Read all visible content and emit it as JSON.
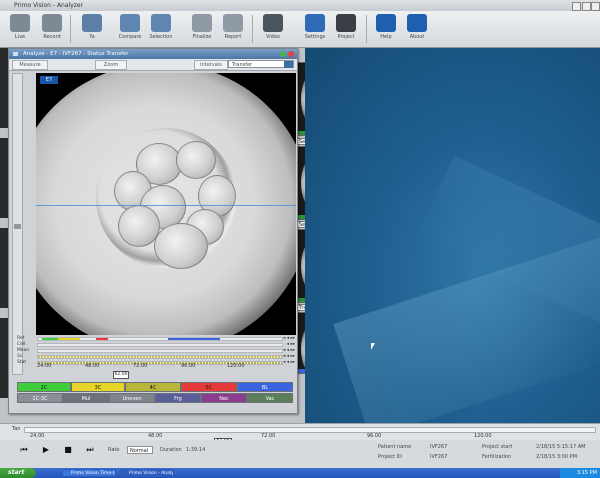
{
  "app": {
    "title": "Primo Vision - Analyzer"
  },
  "toolbar": {
    "items": [
      {
        "label": "Live",
        "icon": "live-icon",
        "color": "#7d8a96"
      },
      {
        "label": "Record",
        "icon": "record-icon",
        "color": "#7d8a96"
      },
      {
        "label": "Ya",
        "icon": "monitor-icon",
        "color": "#5b7fa6"
      },
      {
        "label": "Compare",
        "icon": "compare-icon",
        "color": "#5f86b0"
      },
      {
        "label": "Selection",
        "icon": "selection-icon",
        "color": "#5f86b0"
      },
      {
        "label": "Finalize",
        "icon": "finalize-icon",
        "color": "#8f9aa4"
      },
      {
        "label": "Report",
        "icon": "report-icon",
        "color": "#8f9aa4"
      },
      {
        "label": "Video",
        "icon": "video-icon",
        "color": "#4b5560"
      },
      {
        "label": "Settings",
        "icon": "settings-icon",
        "color": "#2e6bb8"
      },
      {
        "label": "Project",
        "icon": "project-icon",
        "color": "#3a3f45"
      },
      {
        "label": "Help",
        "icon": "help-icon",
        "color": "#1f5fb0"
      },
      {
        "label": "About",
        "icon": "about-icon",
        "color": "#1f5fb0"
      }
    ]
  },
  "analyzer": {
    "window_title": "Analyze - E7 - IVF267 - Status Transfer",
    "toolbar": {
      "measure": "Measure",
      "zoom": "Zoom",
      "intervals": "Intervals",
      "mode_value": "Transfer"
    },
    "embryo_label": "E7",
    "tracks": [
      {
        "name": "Ref",
        "marks": "◂ ◂ ▸▸"
      },
      {
        "name": "Cell",
        "marks": "◂ ▸▸"
      },
      {
        "name": "Mean",
        "marks": "◂ ◂ ▸▸"
      },
      {
        "name": "Sc",
        "marks": "◂ ◂ ▸▸"
      },
      {
        "name": "Stat",
        "marks": "◂ ◂ ▸▸"
      }
    ],
    "time_ticks": [
      "24.00",
      "48.00",
      "72.00",
      "96.00",
      "120.00"
    ],
    "position_value": "62.00",
    "classes_row1": [
      {
        "label": "2C",
        "color": "#3fce3a"
      },
      {
        "label": "3C",
        "color": "#e7d629"
      },
      {
        "label": "4C",
        "color": "#b7b53c"
      },
      {
        "label": "5C",
        "color": "#e63a3a"
      },
      {
        "label": "BL",
        "color": "#3a64e0"
      }
    ],
    "classes_row2": [
      {
        "label": "1C-3C",
        "color": "#8a8f96"
      },
      {
        "label": "Mul",
        "color": "#6d7279"
      },
      {
        "label": "Uneven",
        "color": "#7f838a"
      },
      {
        "label": "Frg",
        "color": "#5b5f99"
      },
      {
        "label": "Nec",
        "color": "#8a3c8f"
      },
      {
        "label": "Vac",
        "color": "#5b7f5b"
      }
    ]
  },
  "thumbnails": [
    {
      "select": "",
      "bar_color": "#2f8f3a"
    },
    {
      "select": "Sel",
      "bar_color": "#2f8f3a"
    },
    {
      "select": "Sel",
      "bar_color": "#2f8f3a"
    },
    {
      "select": "Transfer",
      "bar_color": "#3a64e0"
    }
  ],
  "timeline": {
    "label": "Tan",
    "ticks": [
      "24.00",
      "48.00",
      "72.00",
      "96.00",
      "120.00"
    ],
    "position_value": "62.00"
  },
  "player": {
    "rate_label": "Rate",
    "rate_value": "Normal",
    "duration_label": "Duration",
    "duration_value": "1:39:14"
  },
  "info": {
    "patient_name_label": "Patient name",
    "patient_name_value": "IVF267",
    "project_id_label": "Project ID",
    "project_id_value": "IVF267",
    "project_start_label": "Project start",
    "project_start_value": "2/18/15 5:15:17 AM",
    "fertilization_label": "Fertilization",
    "fertilization_value": "2/18/15 3:00 PM"
  },
  "taskbar": {
    "start_label": "start",
    "tasks": [
      "Primo Vision Time-laps",
      "Primo Vision - Analyzer"
    ],
    "clock": "3:15 PM"
  }
}
